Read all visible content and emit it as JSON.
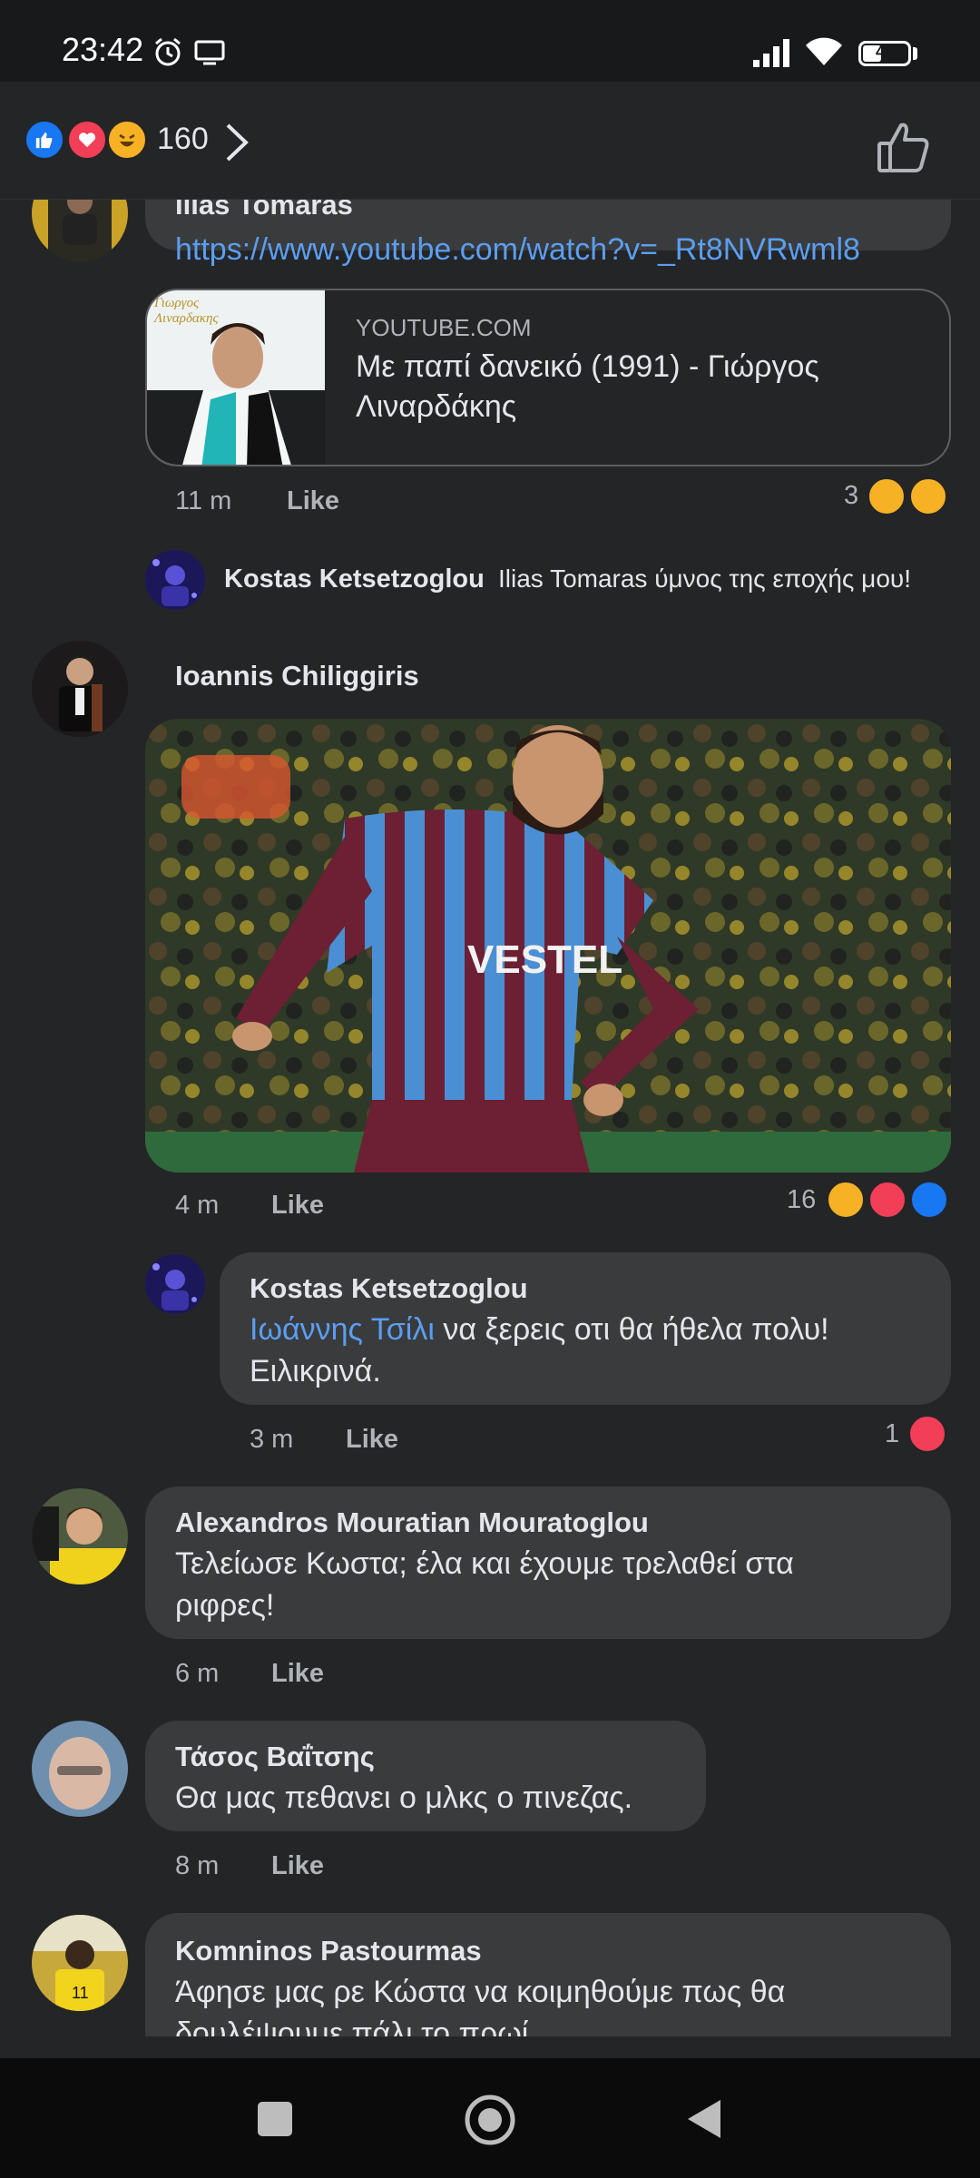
{
  "status_bar": {
    "time": "23:42",
    "battery": "41"
  },
  "header": {
    "reaction_count": "160"
  },
  "comments": [
    {
      "author": "Ilias Tomaras",
      "text": "https://www.youtube.com/watch?v=_Rt8NVRwml8",
      "link_preview": {
        "domain": "YOUTUBE.COM",
        "title": "Με παπί δανεικό (1991) - Γιώργος Λιναρδάκης",
        "thumb_label": "Γιωργος Λιναρδακης"
      },
      "time": "11 m",
      "like_label": "Like",
      "reaction_count": "3"
    },
    {
      "author": "Kostas Ketsetzoglou",
      "mention": "Ilias Tomaras",
      "text": "ύμνος της εποχής μου!"
    },
    {
      "author": "Ioannis Chiliggiris",
      "photo_label": "VESTEL",
      "time": "4 m",
      "like_label": "Like",
      "reaction_count": "16"
    },
    {
      "author": "Kostas Ketsetzoglou",
      "mention": "Ιωάννης Τσίλι",
      "text_line1": " να ξερεις οτι θα ήθελα  πολυ!",
      "text_line2": "Ειλικρινά.",
      "time": "3 m",
      "like_label": "Like",
      "reaction_count": "1"
    },
    {
      "author": "Alexandros Mouratian Mouratoglou",
      "text_line1": "Τελείωσε Κωστα; έλα και έχουμε τρελαθεί στα",
      "text_line2": "ριφρες!",
      "time": "6 m",
      "like_label": "Like"
    },
    {
      "author": "Τάσος Βαΐτσης",
      "text": "Θα μας πεθανει ο μλκς ο πινεζας.",
      "time": "8 m",
      "like_label": "Like"
    },
    {
      "author": "Komninos Pastourmas",
      "text_line1": "Άφησε μας ρε Κώστα να κοιμηθούμε πως θα",
      "text_line2": "δουλέψουμε πάλι το πρωί . . ."
    }
  ]
}
